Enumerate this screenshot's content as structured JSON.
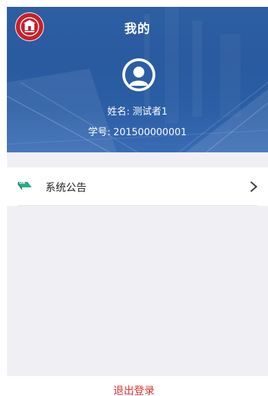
{
  "header": {
    "title": "我的",
    "logo_icon": "university-seal-icon",
    "avatar_icon": "user-avatar-icon",
    "name_label": "姓名:",
    "name_value": "测试者1",
    "id_label": "学号:",
    "id_value": "201500000001",
    "background_color": "#2b5ea5"
  },
  "menu": {
    "items": [
      {
        "label": "系统公告",
        "icon": "announcement-icon",
        "accent_color": "#27a98a"
      }
    ]
  },
  "logout": {
    "label": "退出登录",
    "color": "#e0312d"
  }
}
